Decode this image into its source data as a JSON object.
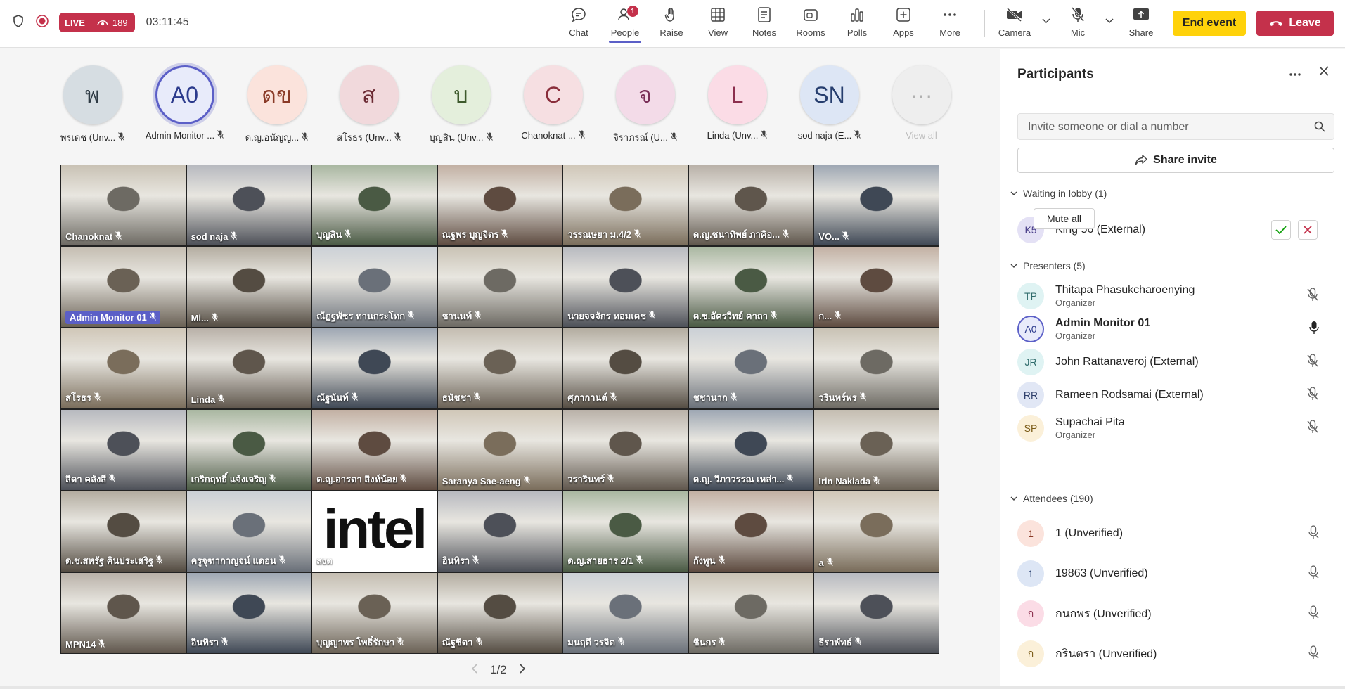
{
  "topbar": {
    "live_label": "LIVE",
    "viewers": "189",
    "timer": "03:11:45",
    "tools": [
      {
        "label": "Chat",
        "icon": "chat-icon"
      },
      {
        "label": "People",
        "icon": "people-icon",
        "badge": "1",
        "active": true
      },
      {
        "label": "Raise",
        "icon": "hand-icon"
      },
      {
        "label": "View",
        "icon": "grid-icon"
      },
      {
        "label": "Notes",
        "icon": "notes-icon"
      },
      {
        "label": "Rooms",
        "icon": "rooms-icon"
      },
      {
        "label": "Polls",
        "icon": "polls-icon"
      },
      {
        "label": "Apps",
        "icon": "apps-icon"
      },
      {
        "label": "More",
        "icon": "more-icon"
      }
    ],
    "camera_label": "Camera",
    "mic_label": "Mic",
    "share_label": "Share",
    "end_event_label": "End event",
    "leave_label": "Leave"
  },
  "avatar_strip": [
    {
      "initials": "พ",
      "name": "พรเดช (Unv...",
      "bg": "#d6dde2",
      "fg": "#2e3a44"
    },
    {
      "initials": "A0",
      "name": "Admin Monitor ...",
      "bg": "#e8ebfa",
      "fg": "#2b3a8c",
      "active": true
    },
    {
      "initials": "ดข",
      "name": "ด.ญ.อนัญญ...",
      "bg": "#fbe3dc",
      "fg": "#8a3a27"
    },
    {
      "initials": "ส",
      "name": "สโรธร (Unv...",
      "bg": "#f1d9dc",
      "fg": "#6b2a33"
    },
    {
      "initials": "บ",
      "name": "บุญสิน (Unv...",
      "bg": "#e4efdc",
      "fg": "#3d5a2c"
    },
    {
      "initials": "C",
      "name": "Chanoknat ...",
      "bg": "#f6dfe2",
      "fg": "#8a2e3b"
    },
    {
      "initials": "จ",
      "name": "จิราภรณ์ (U...",
      "bg": "#f3dbe8",
      "fg": "#7a2f58"
    },
    {
      "initials": "L",
      "name": "Linda (Unv...",
      "bg": "#fbdce6",
      "fg": "#8c2f4e"
    },
    {
      "initials": "SN",
      "name": "sod naja (E...",
      "bg": "#dde6f5",
      "fg": "#273f6f"
    },
    {
      "initials": "···",
      "name": "View all",
      "bg": "#eeeeee",
      "fg": "#b0b0b0",
      "dim": true
    }
  ],
  "grid": {
    "tiles": [
      "Chanoknat",
      "sod naja",
      "บุญสิน",
      "ณฐพร บุญจิตร",
      "วรรณษยา ม.4/2",
      "ด.ญ.ชนาทิพย์ ภาคิอ...",
      "VO...",
      "Admin Monitor 01",
      "Mi...",
      "ณัฏฐพัชร ทานกระโทก",
      "ชานนท์",
      "นายจจจักร หอมเดช",
      "ด.ช.อัครวิทย์  คาถา",
      "ก...",
      "สโรธร",
      "Linda",
      "ณัฐนันท์",
      "ธนัชชา",
      "ศุภากานต์",
      "ชชานาก",
      "วรินทร์พร",
      "สิดา คลังสี",
      "เกริกฤทธิ์ แจ้งเจริญ",
      "ด.ญ.อารดา สิงห์น้อย",
      "Saranya Sae-aeng",
      "วรารินทร์",
      "ด.ญ. วิภาวรรณ เหล่า...",
      "Irin Naklada",
      "ด.ช.สหรัฐ คินประเสริฐ",
      "ครูจุฑากาญจน์ แดอน",
      "สงด",
      "อินทิรา",
      "ด.ญ.สายธาร 2/1",
      "กังพูน",
      "a",
      "MPN14",
      "อินทิรา",
      "บุญญาพร โพธิ์รักษา",
      "ณัฐชิดา",
      "มนฤดี วรจิต",
      "ชินกร",
      "ธีราพัทธ์"
    ],
    "intel_text": "intel",
    "page_indicator": "1/2"
  },
  "panel": {
    "title": "Participants",
    "search_placeholder": "Invite someone or dial a number",
    "share_invite_label": "Share invite",
    "lobby_header": "Waiting in lobby (1)",
    "lobby": [
      {
        "initials": "K5",
        "name": "King 56 (External)",
        "bg": "#e4e1f5",
        "fg": "#4a3f8a"
      }
    ],
    "presenters_header": "Presenters (5)",
    "mute_all_label": "Mute all",
    "presenters": [
      {
        "initials": "TP",
        "name": "Thitapa Phasukcharoenying",
        "role": "Organizer",
        "bg": "#dff3f3",
        "fg": "#2e6b6b",
        "mic": "muted"
      },
      {
        "initials": "A0",
        "name": "Admin Monitor 01",
        "role": "Organizer",
        "bg": "#e8ebfa",
        "fg": "#2b3a8c",
        "mic": "on",
        "bold": true
      },
      {
        "initials": "JR",
        "name": "John Rattanaveroj (External)",
        "role": "",
        "bg": "#dff3f3",
        "fg": "#2e6b6b",
        "mic": "muted"
      },
      {
        "initials": "RR",
        "name": "Rameen Rodsamai (External)",
        "role": "",
        "bg": "#e1e7f5",
        "fg": "#2e3f6b",
        "mic": "muted"
      },
      {
        "initials": "SP",
        "name": "Supachai Pita",
        "role": "Organizer",
        "bg": "#fbf0d9",
        "fg": "#7a5a16",
        "mic": "muted"
      }
    ],
    "attendees_header": "Attendees (190)",
    "attendees": [
      {
        "initials": "1",
        "name": "1 (Unverified)",
        "bg": "#fbe3dc",
        "fg": "#8a3a27"
      },
      {
        "initials": "1",
        "name": "19863 (Unverified)",
        "bg": "#dde6f5",
        "fg": "#273f6f"
      },
      {
        "initials": "ก",
        "name": "กนกพร (Unverified)",
        "bg": "#fbdce6",
        "fg": "#8c2f4e"
      },
      {
        "initials": "ก",
        "name": "กรินตรา (Unverified)",
        "bg": "#fbf0d9",
        "fg": "#7a5a16"
      }
    ]
  }
}
